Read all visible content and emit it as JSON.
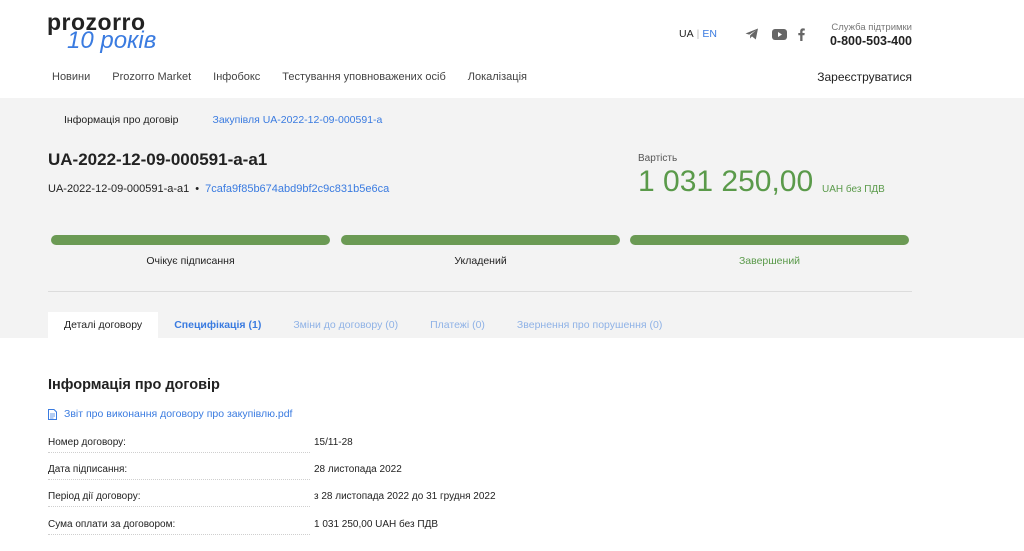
{
  "header": {
    "logo_top": "prozorro",
    "logo_bottom": "10 років",
    "lang_ua": "UA",
    "lang_en": "EN",
    "social": [
      "telegram-icon",
      "youtube-icon",
      "facebook-icon"
    ],
    "support_label": "Служба підтримки",
    "support_phone": "0-800-503-400",
    "nav": [
      "Новини",
      "Prozorro Market",
      "Інфобокс",
      "Тестування уповноважених осіб",
      "Локалізація"
    ],
    "register": "Зареєструватися"
  },
  "breadcrumbs": {
    "current": "Інформація про договір",
    "link": "Закупівля UA-2022-12-09-000591-a"
  },
  "contract": {
    "title": "UA-2022-12-09-000591-a-a1",
    "id": "UA-2022-12-09-000591-a-a1",
    "dot": "•",
    "hash": "7cafa9f85b674abd9bf2c9c831b5e6ca",
    "cost_label": "Вартість",
    "cost_value": "1 031 250,00",
    "cost_unit": "UAH без ПДВ"
  },
  "statuses": [
    {
      "label": "Очікує підписання",
      "filled": 1
    },
    {
      "label": "Укладений",
      "filled": 1
    },
    {
      "label": "Завершений",
      "filled": 1
    }
  ],
  "tabs": [
    {
      "label": "Деталі договору",
      "state": "active"
    },
    {
      "label": "Специфікація (1)",
      "state": "blue"
    },
    {
      "label": "Зміни до договору (0)",
      "state": "muted"
    },
    {
      "label": "Платежі (0)",
      "state": "muted"
    },
    {
      "label": "Звернення про порушення (0)",
      "state": "muted"
    }
  ],
  "info": {
    "title": "Інформація про договір",
    "doc_link": "Звіт про виконання договору про закупівлю.pdf",
    "rows": [
      {
        "key": "Номер договору:",
        "value": "15/11-28"
      },
      {
        "key": "Дата підписання:",
        "value": "28 листопада 2022"
      },
      {
        "key": "Період дії договору:",
        "value": "з 28 листопада 2022 до 31 грудня 2022"
      },
      {
        "key": "Сума оплати за договором:",
        "value": "1 031 250,00 UAH без ПДВ"
      }
    ]
  },
  "colors": {
    "accent": "#3a7be0",
    "success": "#6b9a54",
    "panel": "#f3f3f3"
  }
}
